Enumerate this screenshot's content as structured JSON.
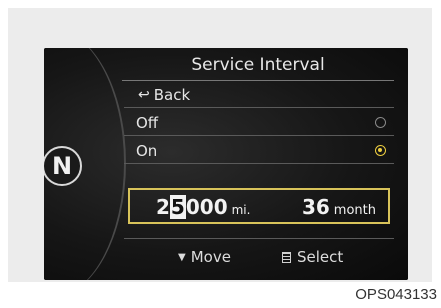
{
  "screen": {
    "title": "Service Interval",
    "gear": "N",
    "back_icon": "↩",
    "back_label": "Back",
    "options": [
      {
        "label": "Off",
        "selected": false
      },
      {
        "label": "On",
        "selected": true
      }
    ],
    "mileage": {
      "digits": [
        "2",
        "5",
        "0",
        "0",
        "0"
      ],
      "cursor_index": 1,
      "unit": "mi."
    },
    "months": {
      "value": "36",
      "unit": "month"
    },
    "footer": {
      "move_icon": "▼",
      "move_label": "Move",
      "select_label": "Select"
    },
    "accent_color": "#f0d040"
  },
  "caption": "OPS043133"
}
